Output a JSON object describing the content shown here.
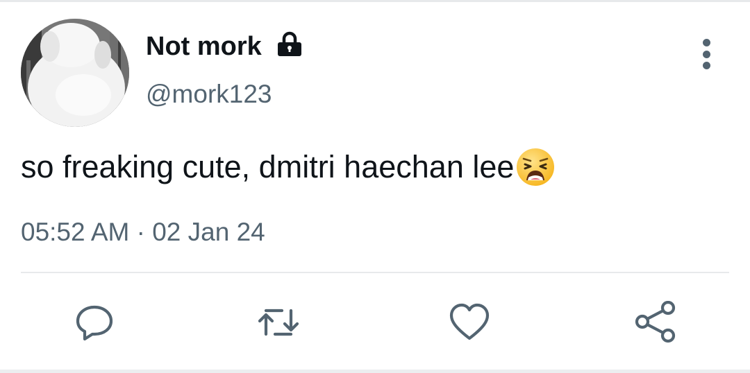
{
  "user": {
    "display_name": "Not mork",
    "handle": "@mork123",
    "avatar_icon": "avatar",
    "protected_icon": "lock-icon"
  },
  "tweet": {
    "text": "so freaking cute, dmitri haechan lee",
    "emoji": "weary-face",
    "timestamp": "05:52 AM · 02 Jan 24"
  },
  "actions": [
    {
      "name": "reply",
      "icon": "reply-icon"
    },
    {
      "name": "retweet",
      "icon": "retweet-icon"
    },
    {
      "name": "like",
      "icon": "heart-icon"
    },
    {
      "name": "share",
      "icon": "share-icon"
    }
  ],
  "colors": {
    "text_primary": "#0f1419",
    "text_secondary": "#536471",
    "divider": "#e7e9eb"
  }
}
